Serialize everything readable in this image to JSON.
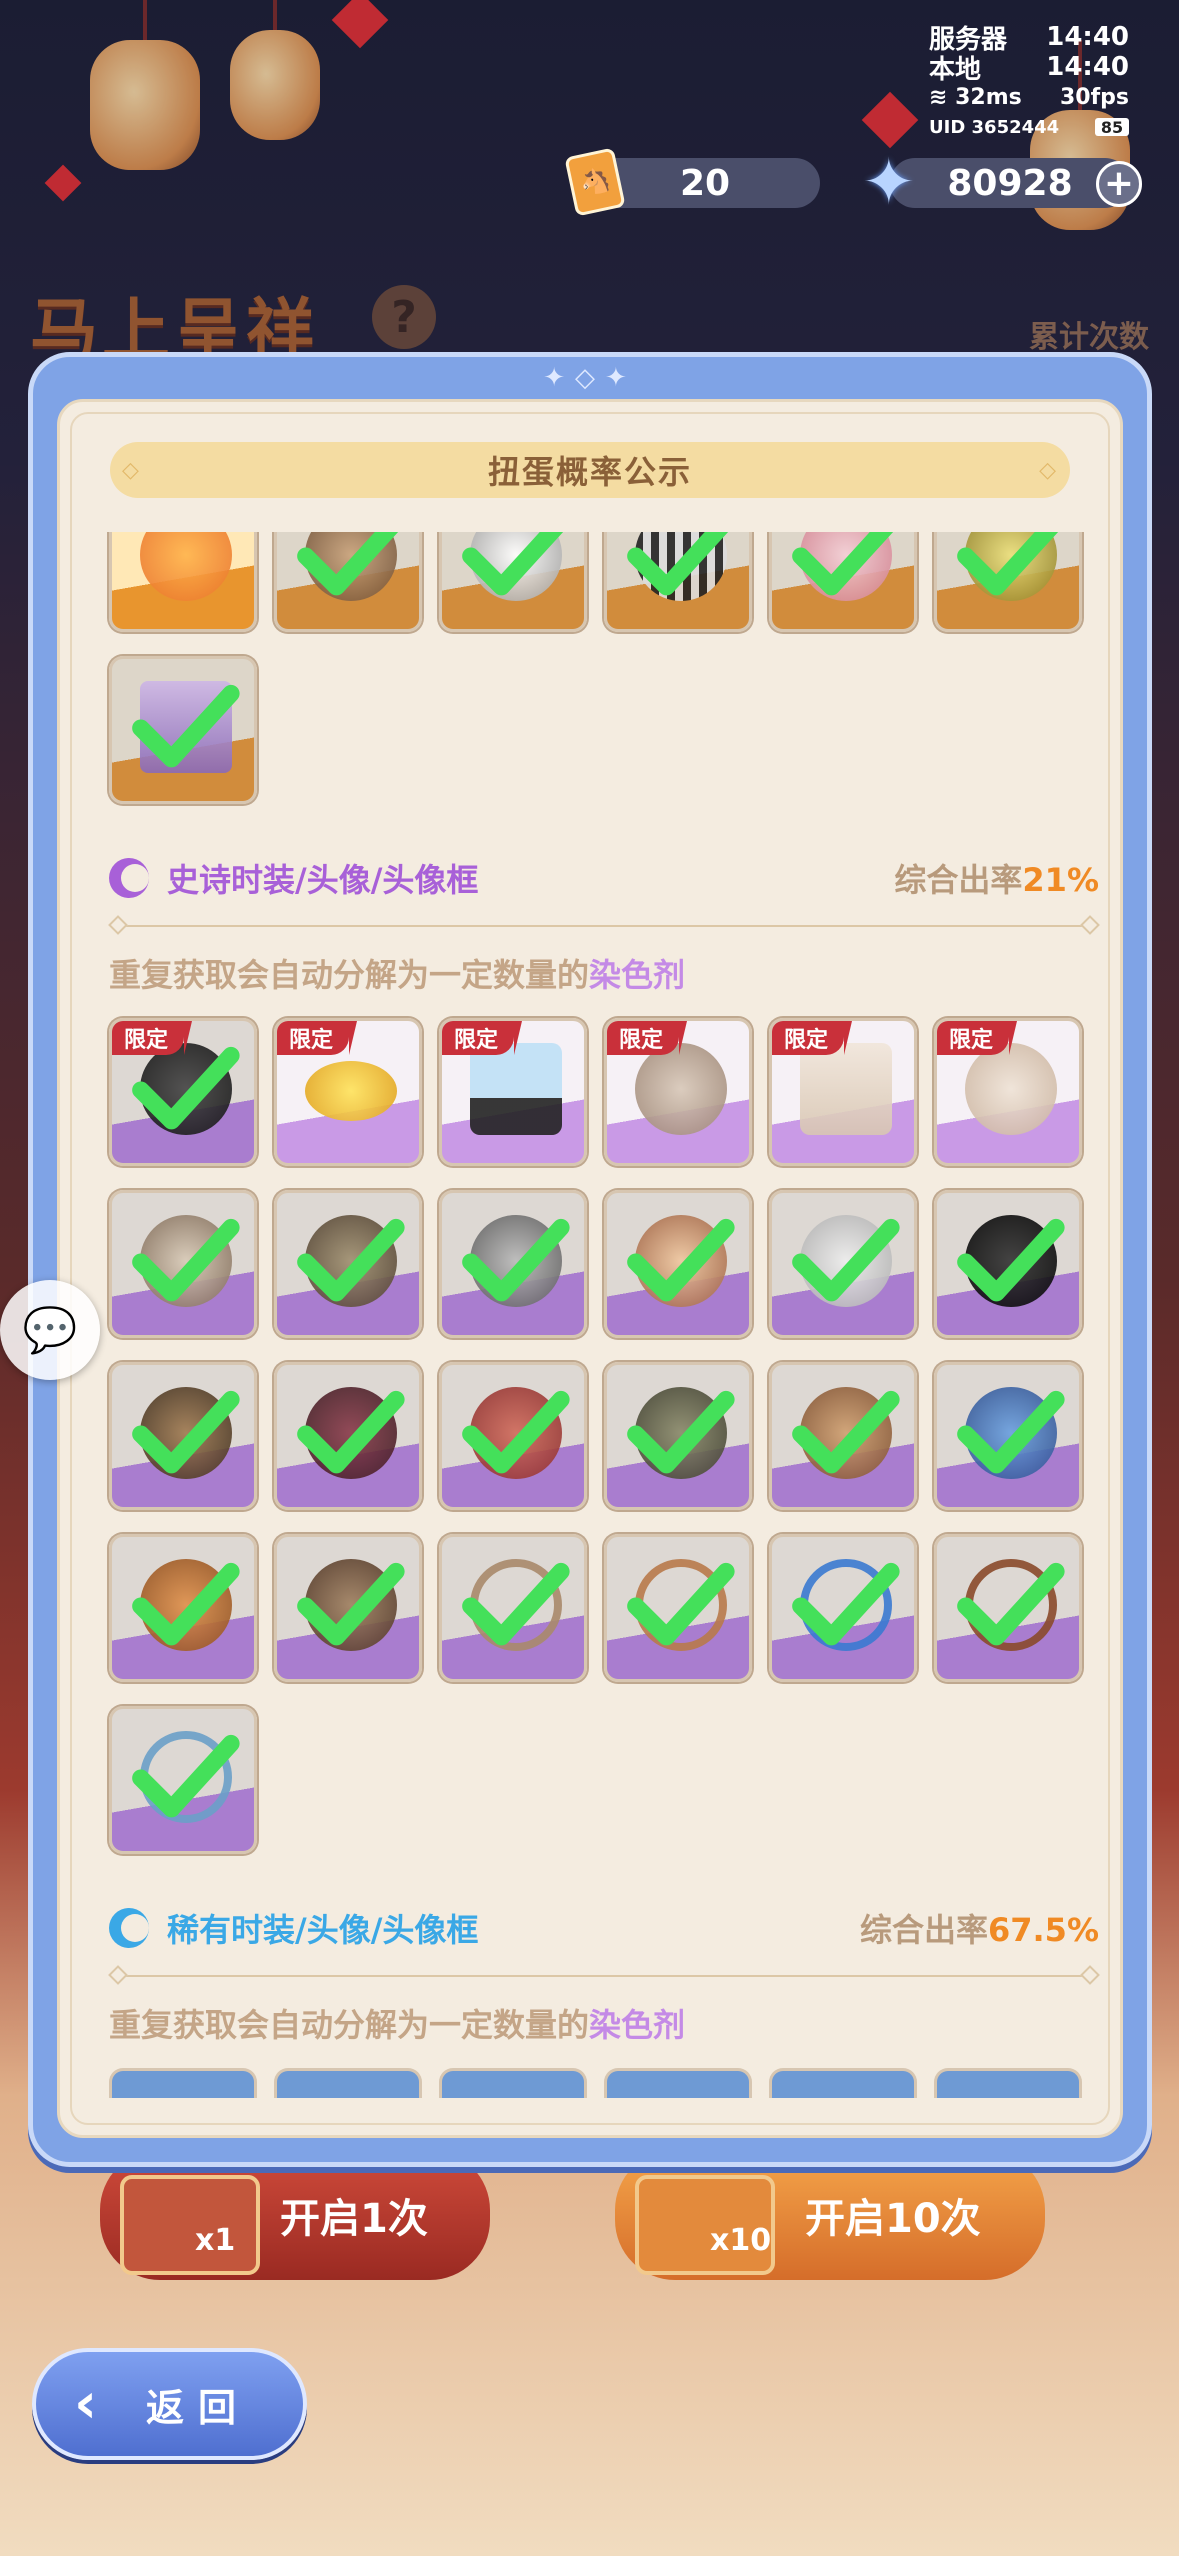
{
  "status": {
    "server_label": "服务器",
    "server_time": "14:40",
    "local_label": "本地",
    "local_time": "14:40",
    "ping": "32ms",
    "fps": "30fps",
    "uid": "UID 3652444",
    "battery": "85"
  },
  "currency": {
    "tickets": "20",
    "stars": "80928",
    "plus": "+"
  },
  "background": {
    "title": "马上呈祥",
    "help": "?",
    "count_label": "累计次数",
    "open_once": "开启1次",
    "open_once_qty": "x1",
    "open_ten": "开启10次",
    "open_ten_qty": "x10"
  },
  "modal": {
    "title": "扭蛋概率公示",
    "epic": {
      "name": "史诗时装/头像/头像框",
      "rate_label": "综合出率",
      "rate_value": "21%",
      "note_prefix": "重复获取会自动分解为一定数量的",
      "note_highlight": "染色剂",
      "limited_label": "限定"
    },
    "rare": {
      "name": "稀有时装/头像/头像框",
      "rate_label": "综合出率",
      "rate_value": "67.5%",
      "note_prefix": "重复获取会自动分解为一定数量的",
      "note_highlight": "染色剂"
    }
  },
  "back_button": {
    "label": "返回"
  },
  "colors": {
    "modal_frame": "#7fa3e6",
    "epic": "#a860d8",
    "rare": "#3aa8e6",
    "rate_value": "#f08a24",
    "check": "#44e05a",
    "limited": "#c9303a"
  }
}
